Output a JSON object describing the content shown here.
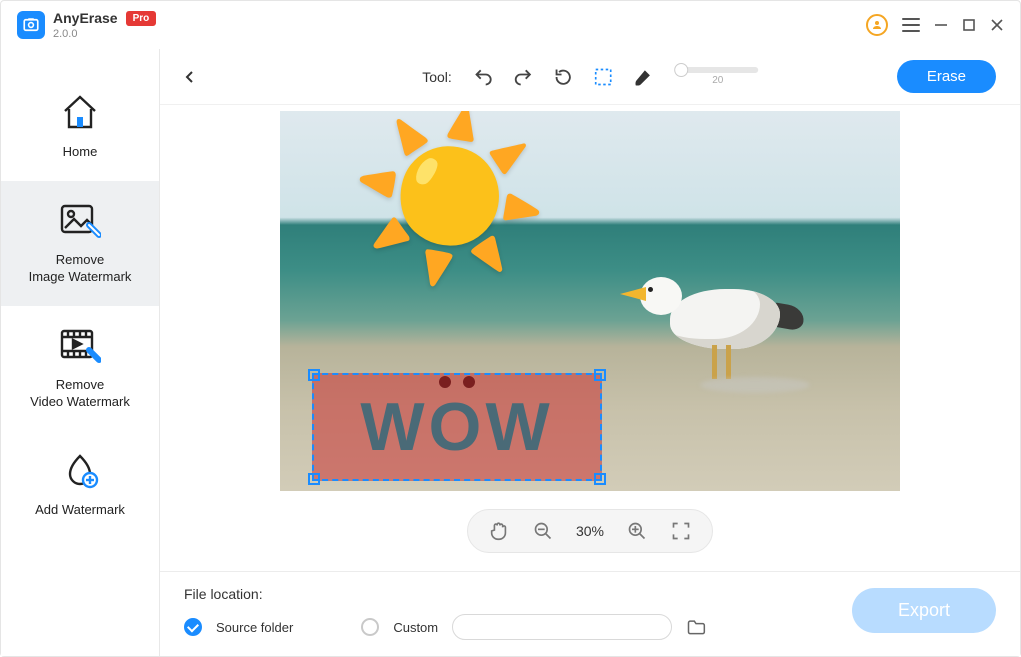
{
  "app": {
    "title": "AnyErase",
    "badge": "Pro",
    "version": "2.0.0"
  },
  "sidebar": {
    "items": [
      {
        "label": "Home"
      },
      {
        "label": "Remove\nImage Watermark"
      },
      {
        "label": "Remove\nVideo Watermark"
      },
      {
        "label": "Add Watermark"
      }
    ]
  },
  "toolbar": {
    "tool_label": "Tool:",
    "brush_size": "20",
    "erase_label": "Erase"
  },
  "canvas": {
    "selection_text": "WOW"
  },
  "zoom": {
    "value": "30%"
  },
  "bottom": {
    "file_location_label": "File location:",
    "source_folder_label": "Source folder",
    "custom_label": "Custom",
    "export_label": "Export"
  }
}
